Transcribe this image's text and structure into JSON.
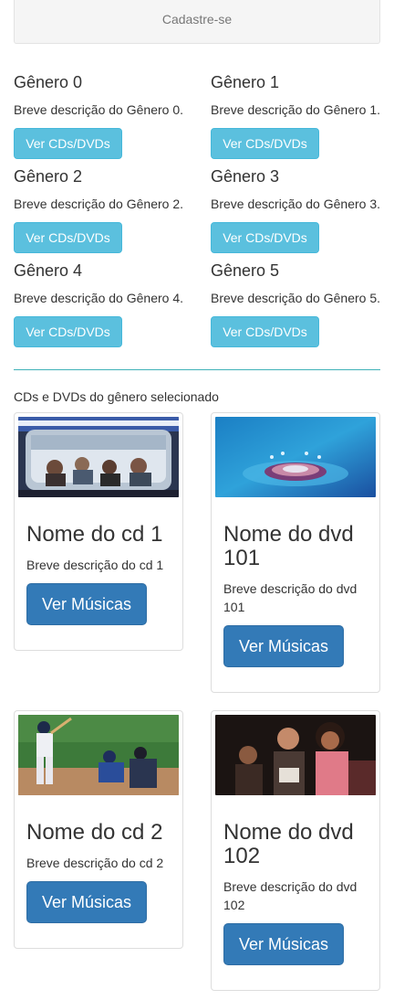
{
  "signup": {
    "label": "Cadastre-se"
  },
  "genres": [
    {
      "title": "Gênero 0",
      "description": "Breve descrição do Gênero 0.",
      "button": "Ver CDs/DVDs"
    },
    {
      "title": "Gênero 1",
      "description": "Breve descrição do Gênero 1.",
      "button": "Ver CDs/DVDs"
    },
    {
      "title": "Gênero 2",
      "description": "Breve descrição do Gênero 2.",
      "button": "Ver CDs/DVDs"
    },
    {
      "title": "Gênero 3",
      "description": "Breve descrição do Gênero 3.",
      "button": "Ver CDs/DVDs"
    },
    {
      "title": "Gênero 4",
      "description": "Breve descrição do Gênero 4.",
      "button": "Ver CDs/DVDs"
    },
    {
      "title": "Gênero 5",
      "description": "Breve descrição do Gênero 5.",
      "button": "Ver CDs/DVDs"
    }
  ],
  "section": {
    "title": "CDs e DVDs do gênero selecionado"
  },
  "items": [
    {
      "title": "Nome do cd 1",
      "description": "Breve descrição do cd 1",
      "button": "Ver Músicas"
    },
    {
      "title": "Nome do dvd 101",
      "description": "Breve descrição do dvd 101",
      "button": "Ver Músicas"
    },
    {
      "title": "Nome do cd 2",
      "description": "Breve descrição do cd 2",
      "button": "Ver Músicas"
    },
    {
      "title": "Nome do dvd 102",
      "description": "Breve descrição do dvd 102",
      "button": "Ver Músicas"
    }
  ],
  "colors": {
    "info_button": "#5bc0de",
    "primary_button": "#337ab7",
    "divider": "#3fb2b8"
  }
}
